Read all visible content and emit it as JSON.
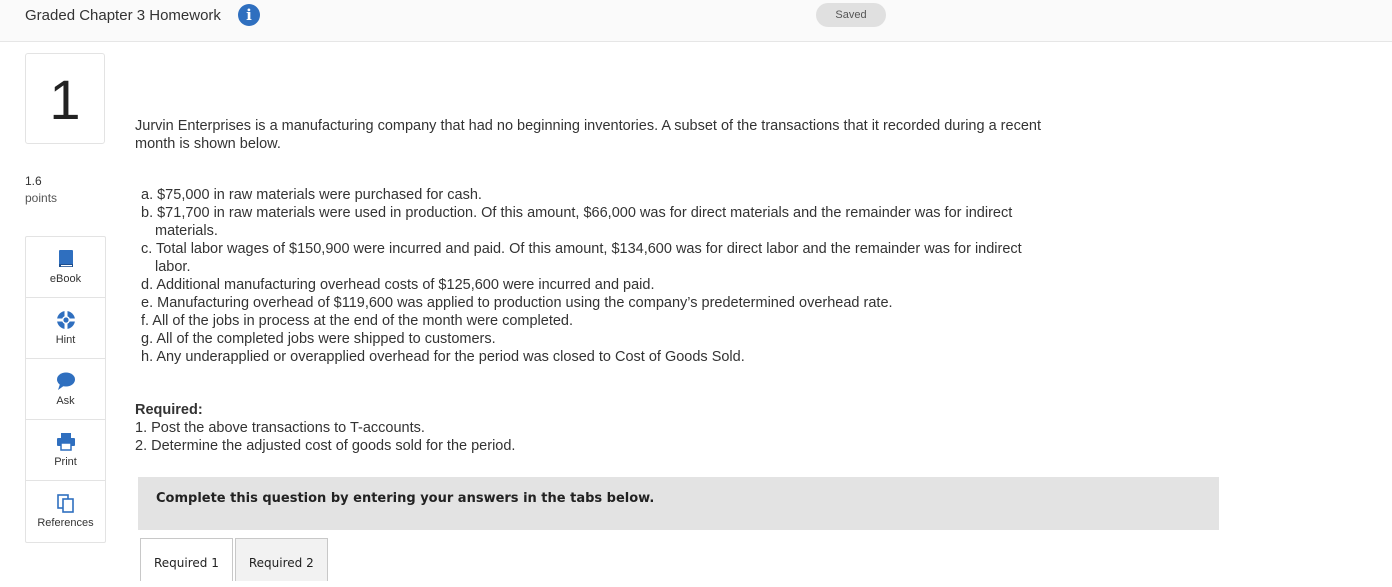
{
  "header": {
    "title": "Graded Chapter 3 Homework",
    "info_icon": "i",
    "saved_label": "Saved"
  },
  "question": {
    "number": "1",
    "points_value": "1.6",
    "points_label": "points"
  },
  "tools": [
    {
      "label": "eBook",
      "icon": "book-icon"
    },
    {
      "label": "Hint",
      "icon": "lifebuoy-icon"
    },
    {
      "label": "Ask",
      "icon": "chat-bubble-icon"
    },
    {
      "label": "Print",
      "icon": "printer-icon"
    },
    {
      "label": "References",
      "icon": "documents-icon"
    }
  ],
  "colors": {
    "accent": "#2f6fbf",
    "banner": "#e3e3e3"
  },
  "body": {
    "intro": "Jurvin Enterprises is a manufacturing company that had no beginning inventories. A subset of the transactions that it recorded during a recent month is shown below.",
    "transactions": [
      "a. $75,000 in raw materials were purchased for cash.",
      "b. $71,700 in raw materials were used in production. Of this amount, $66,000 was for direct materials and the remainder was for indirect materials.",
      "c. Total labor wages of $150,900 were incurred and paid. Of this amount, $134,600 was for direct labor and the remainder was for indirect labor.",
      "d. Additional manufacturing overhead costs of $125,600 were incurred and paid.",
      "e. Manufacturing overhead of $119,600 was applied to production using the company’s predetermined overhead rate.",
      "f. All of the jobs in process at the end of the month were completed.",
      "g. All of the completed jobs were shipped to customers.",
      "h. Any underapplied or overapplied overhead for the period was closed to Cost of Goods Sold."
    ],
    "required_title": "Required:",
    "required_items": [
      "1. Post the above transactions to T-accounts.",
      "2. Determine the adjusted cost of goods sold for the period."
    ],
    "banner": "Complete this question by entering your answers in the tabs below."
  },
  "tabs": [
    {
      "label": "Required 1"
    },
    {
      "label": "Required 2"
    }
  ]
}
